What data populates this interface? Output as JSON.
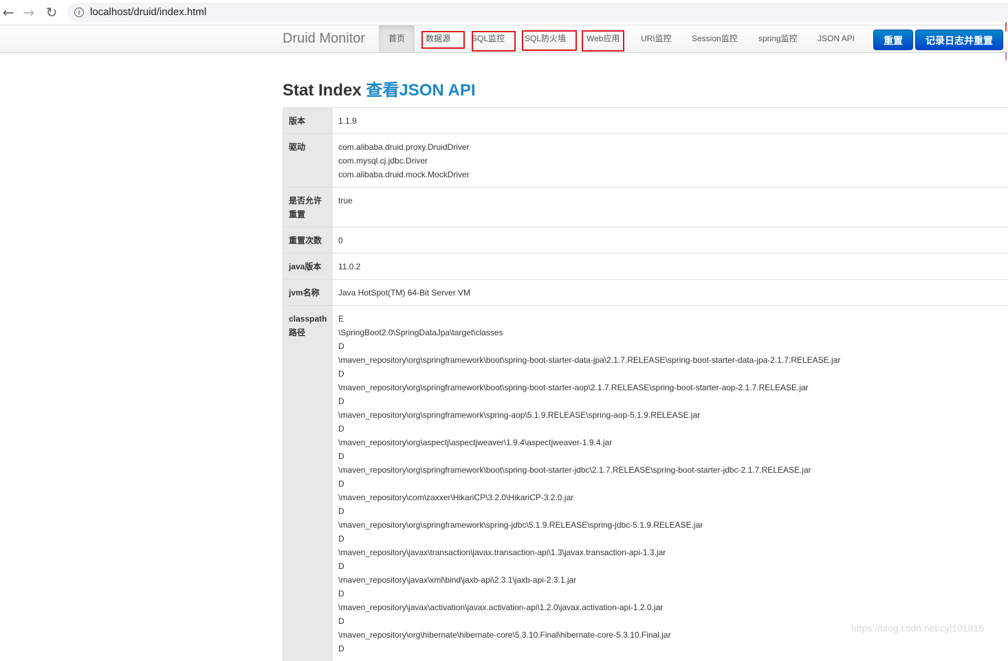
{
  "browser": {
    "url": "localhost/druid/index.html",
    "back_icon": "←",
    "forward_icon": "→",
    "reload_icon": "↻",
    "info_icon": "i"
  },
  "navbar": {
    "brand": "Druid Monitor",
    "items": [
      {
        "label": "首页",
        "active": true,
        "highlighted": false
      },
      {
        "label": "数据源",
        "active": false,
        "highlighted": true
      },
      {
        "label": "SQL监控",
        "active": false,
        "highlighted": true
      },
      {
        "label": "SQL防火墙",
        "active": false,
        "highlighted": true
      },
      {
        "label": "Web应用",
        "active": false,
        "highlighted": true
      },
      {
        "label": "URI监控",
        "active": false,
        "highlighted": false
      },
      {
        "label": "Session监控",
        "active": false,
        "highlighted": false
      },
      {
        "label": "spring监控",
        "active": false,
        "highlighted": false
      },
      {
        "label": "JSON API",
        "active": false,
        "highlighted": false
      }
    ],
    "reset_button": "重置",
    "log_reset_button": "记录日志并重置"
  },
  "content": {
    "title": "Stat Index",
    "title_link": "查看JSON API",
    "rows": [
      {
        "key": "版本",
        "lines": [
          "1.1.9"
        ]
      },
      {
        "key": "驱动",
        "lines": [
          "com.alibaba.druid.proxy.DruidDriver",
          "com.mysql.cj.jdbc.Driver",
          "com.alibaba.druid.mock.MockDriver"
        ]
      },
      {
        "key": "是否允许重置",
        "lines": [
          "true",
          ""
        ]
      },
      {
        "key": "重置次数",
        "lines": [
          "0"
        ]
      },
      {
        "key": "java版本",
        "lines": [
          "11.0.2"
        ]
      },
      {
        "key": "jvm名称",
        "lines": [
          "Java HotSpot(TM) 64-Bit Server VM"
        ]
      },
      {
        "key": "classpath路径",
        "lines": [
          "E",
          "\\SpringBoot2.0\\SpringDataJpa\\target\\classes",
          "D",
          "\\maven_repository\\org\\springframework\\boot\\spring-boot-starter-data-jpa\\2.1.7.RELEASE\\spring-boot-starter-data-jpa-2.1.7.RELEASE.jar",
          "D",
          "\\maven_repository\\org\\springframework\\boot\\spring-boot-starter-aop\\2.1.7.RELEASE\\spring-boot-starter-aop-2.1.7.RELEASE.jar",
          "D",
          "\\maven_repository\\org\\springframework\\spring-aop\\5.1.9.RELEASE\\spring-aop-5.1.9.RELEASE.jar",
          "D",
          "\\maven_repository\\org\\aspectj\\aspectjweaver\\1.9.4\\aspectjweaver-1.9.4.jar",
          "D",
          "\\maven_repository\\org\\springframework\\boot\\spring-boot-starter-jdbc\\2.1.7.RELEASE\\spring-boot-starter-jdbc-2.1.7.RELEASE.jar",
          "D",
          "\\maven_repository\\com\\zaxxer\\HikariCP\\3.2.0\\HikariCP-3.2.0.jar",
          "D",
          "\\maven_repository\\org\\springframework\\spring-jdbc\\5.1.9.RELEASE\\spring-jdbc-5.1.9.RELEASE.jar",
          "D",
          "\\maven_repository\\javax\\transaction\\javax.transaction-api\\1.3\\javax.transaction-api-1.3.jar",
          "D",
          "\\maven_repository\\javax\\xml\\bind\\jaxb-api\\2.3.1\\jaxb-api-2.3.1.jar",
          "D",
          "\\maven_repository\\javax\\activation\\javax.activation-api\\1.2.0\\javax.activation-api-1.2.0.jar",
          "D",
          "\\maven_repository\\org\\hibernate\\hibernate-core\\5.3.10.Final\\hibernate-core-5.3.10.Final.jar",
          "D"
        ]
      }
    ]
  },
  "watermark": "https://blog.csdn.net/cyl101816",
  "colors": {
    "highlight_box": "#e0191e",
    "primary_button": "#0055cc",
    "link": "#1a87c9"
  }
}
